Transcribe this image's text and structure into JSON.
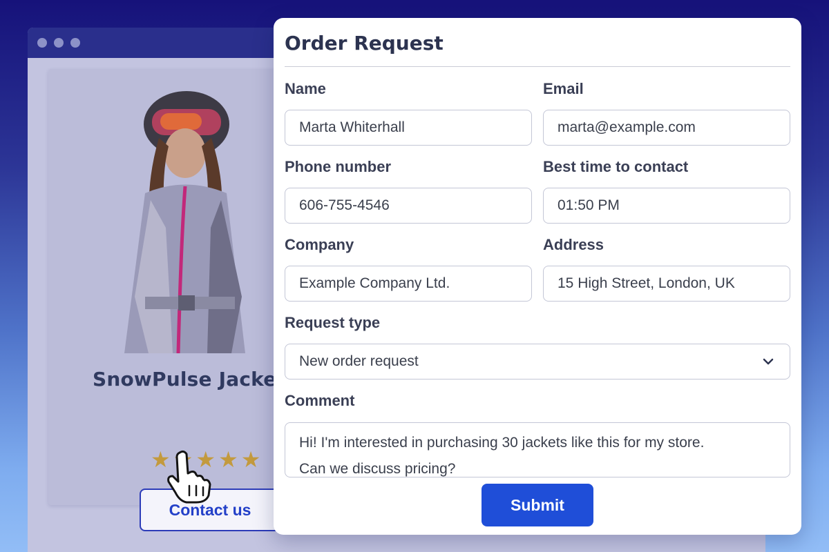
{
  "product": {
    "title": "SnowPulse Jacke",
    "rating_stars": 5,
    "contact_button": "Contact us"
  },
  "form": {
    "title": "Order Request",
    "fields": {
      "name": {
        "label": "Name",
        "value": "Marta Whiterhall"
      },
      "email": {
        "label": "Email",
        "value": "marta@example.com"
      },
      "phone": {
        "label": "Phone number",
        "value": "606-755-4546"
      },
      "best_time": {
        "label": "Best time to contact",
        "value": "01:50 PM"
      },
      "company": {
        "label": "Company",
        "value": "Example Company Ltd."
      },
      "address": {
        "label": "Address",
        "value": "15 High Street, London, UK"
      },
      "request_type": {
        "label": "Request type",
        "value": "New order request"
      },
      "comment": {
        "label": "Comment",
        "line1": "Hi! I'm interested in purchasing 30 jackets like this for my store.",
        "line2": "Can we discuss pricing?"
      }
    },
    "submit_label": "Submit"
  },
  "colors": {
    "accent": "#1f4ed8",
    "star": "#c39a3e"
  }
}
